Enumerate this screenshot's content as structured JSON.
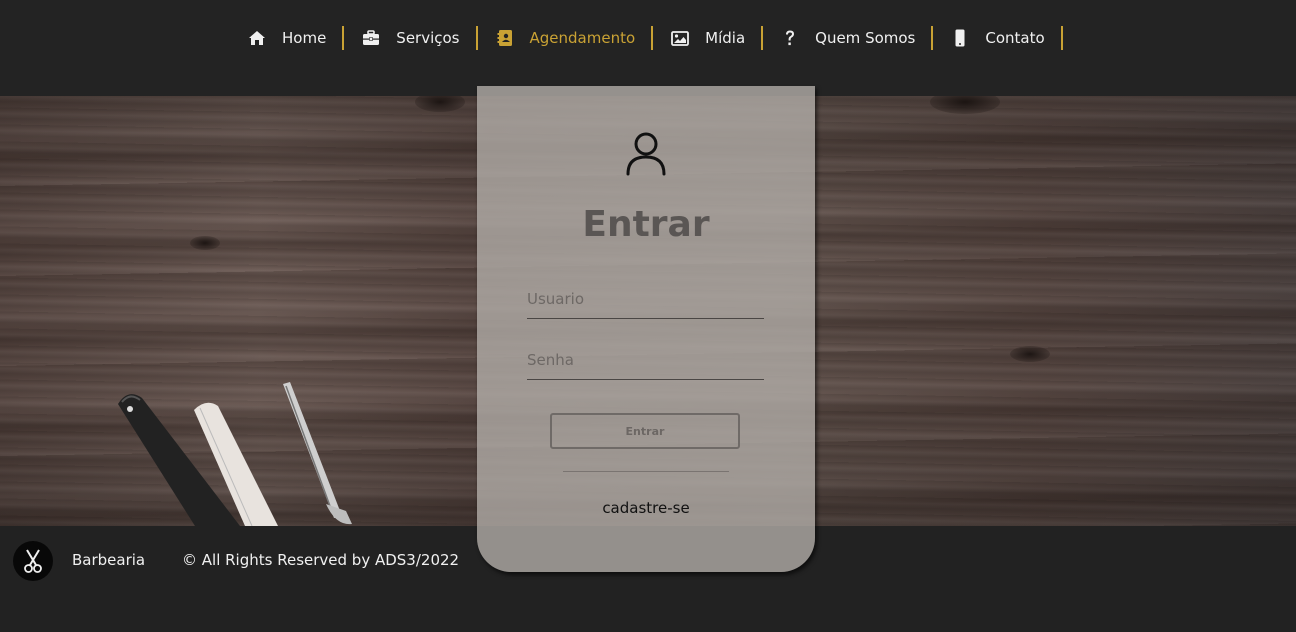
{
  "nav": {
    "items": [
      {
        "label": "Home",
        "icon": "home-icon",
        "active": false
      },
      {
        "label": "Serviços",
        "icon": "briefcase-icon",
        "active": false
      },
      {
        "label": "Agendamento",
        "icon": "address-book-icon",
        "active": true
      },
      {
        "label": "Mídia",
        "icon": "image-icon",
        "active": false
      },
      {
        "label": "Quem Somos",
        "icon": "question-icon",
        "active": false
      },
      {
        "label": "Contato",
        "icon": "mobile-phone-icon",
        "active": false
      }
    ]
  },
  "login": {
    "title": "Entrar",
    "username_placeholder": "Usuario",
    "password_placeholder": "Senha",
    "submit_label": "Entrar",
    "register_link": "cadastre-se"
  },
  "footer": {
    "brand": "Barbearia",
    "copyright": "© All Rights Reserved by ADS3/2022"
  },
  "colors": {
    "background": "#212121",
    "accent": "#c9a234",
    "nav_text": "#f0f0f0",
    "card": "#b2aca8"
  }
}
